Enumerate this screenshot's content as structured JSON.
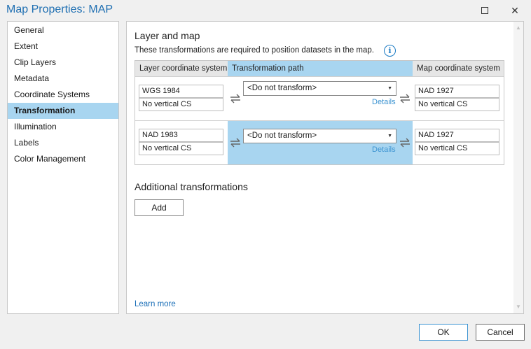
{
  "window": {
    "title": "Map Properties: MAP",
    "maximize_icon": "maximize-icon",
    "close_symbol": "✕"
  },
  "sidebar": {
    "items": [
      {
        "label": "General"
      },
      {
        "label": "Extent"
      },
      {
        "label": "Clip Layers"
      },
      {
        "label": "Metadata"
      },
      {
        "label": "Coordinate Systems"
      },
      {
        "label": "Transformation",
        "selected": true
      },
      {
        "label": "Illumination"
      },
      {
        "label": "Labels"
      },
      {
        "label": "Color Management"
      }
    ],
    "selected_color": "#a8d5f0"
  },
  "main": {
    "section_title": "Layer and map",
    "description": "These transformations are required to position datasets in the map.",
    "info_glyph": "i",
    "table": {
      "headers": {
        "layer_cs": "Layer coordinate system",
        "path": "Transformation path",
        "map_cs": "Map coordinate system"
      },
      "rows": [
        {
          "layer_cs": "WGS 1984",
          "layer_vcs": "No vertical CS",
          "path": "<Do not transform>",
          "details": "Details",
          "map_cs": "NAD 1927",
          "map_vcs": "No vertical CS",
          "highlighted": false
        },
        {
          "layer_cs": "NAD 1983",
          "layer_vcs": "No vertical CS",
          "path": "<Do not transform>",
          "details": "Details",
          "map_cs": "NAD 1927",
          "map_vcs": "No vertical CS",
          "highlighted": true
        }
      ]
    },
    "additional_title": "Additional transformations",
    "add_label": "Add",
    "learn_more": "Learn more"
  },
  "footer": {
    "ok_label": "OK",
    "cancel_label": "Cancel"
  },
  "colors": {
    "title": "#1f6fb2",
    "highlight": "#a8d5f0",
    "link": "#3b93d1"
  }
}
